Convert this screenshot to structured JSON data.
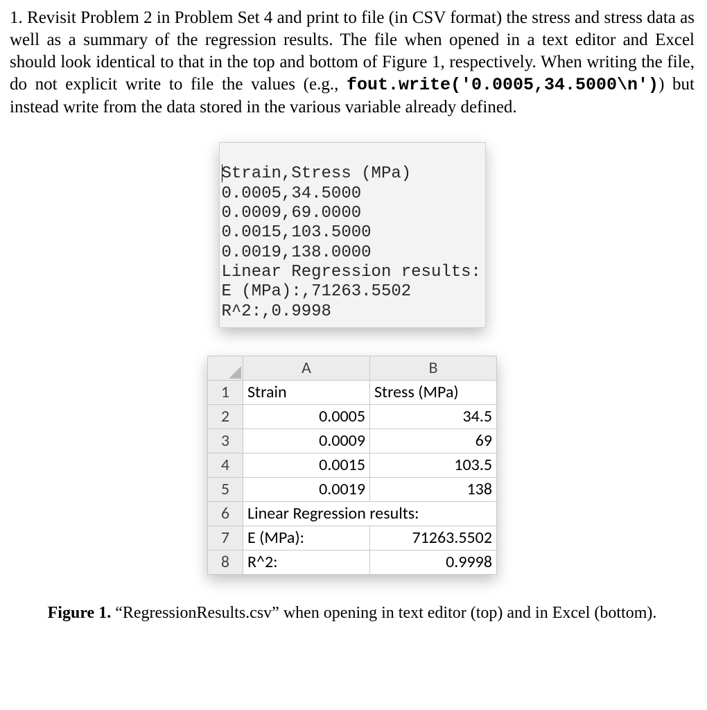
{
  "problem": {
    "number": "1.",
    "text_before_code": "Revisit Problem 2 in Problem Set 4 and print to file (in CSV format) the stress and stress data as well as a summary of the regression results. The file when opened in a text editor and Excel should look identical to that in the top and bottom of Figure 1, respectively. When writing the file, do not explicit write to file the values (e.g., ",
    "code_example": "fout.write('0.0005,34.5000\\n')",
    "text_after_code": ") but instead write from the data stored in the various variable already defined."
  },
  "text_editor": {
    "lines": [
      "Strain,Stress (MPa)",
      "0.0005,34.5000",
      "0.0009,69.0000",
      "0.0015,103.5000",
      "0.0019,138.0000",
      "Linear Regression results:",
      "E (MPa):,71263.5502",
      "R^2:,0.9998"
    ]
  },
  "excel": {
    "col_headers": [
      "A",
      "B"
    ],
    "rows": [
      {
        "n": "1",
        "a": {
          "v": "Strain",
          "align": "txt"
        },
        "b": {
          "v": "Stress (MPa)",
          "align": "txt"
        }
      },
      {
        "n": "2",
        "a": {
          "v": "0.0005",
          "align": "num"
        },
        "b": {
          "v": "34.5",
          "align": "num"
        }
      },
      {
        "n": "3",
        "a": {
          "v": "0.0009",
          "align": "num"
        },
        "b": {
          "v": "69",
          "align": "num"
        }
      },
      {
        "n": "4",
        "a": {
          "v": "0.0015",
          "align": "num"
        },
        "b": {
          "v": "103.5",
          "align": "num"
        }
      },
      {
        "n": "5",
        "a": {
          "v": "0.0019",
          "align": "num"
        },
        "b": {
          "v": "138",
          "align": "num"
        }
      },
      {
        "n": "6",
        "a": {
          "v": "Linear Regression results:",
          "align": "txt",
          "span": 2
        }
      },
      {
        "n": "7",
        "a": {
          "v": "E (MPa):",
          "align": "txt"
        },
        "b": {
          "v": "71263.5502",
          "align": "num"
        }
      },
      {
        "n": "8",
        "a": {
          "v": "R^2:",
          "align": "txt"
        },
        "b": {
          "v": "0.9998",
          "align": "num"
        }
      }
    ]
  },
  "caption": {
    "label": "Figure 1.",
    "text": " “RegressionResults.csv” when opening in text editor (top) and in Excel (bottom)."
  }
}
